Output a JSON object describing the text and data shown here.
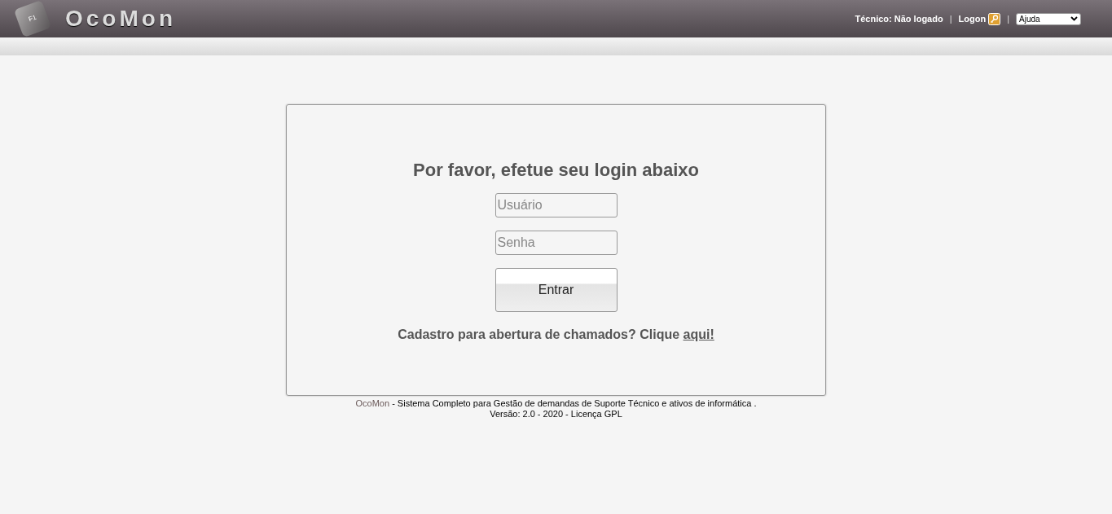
{
  "header": {
    "logo_key": "F1",
    "logo_text": "OcoMon",
    "user_label": "Técnico: Não logado",
    "separator": "|",
    "logon": "Logon",
    "help_select": {
      "value": "Ajuda"
    }
  },
  "login": {
    "title": "Por favor, efetue seu login abaixo",
    "username": {
      "placeholder": "Usuário"
    },
    "password": {
      "placeholder": "Senha"
    },
    "submit": "Entrar",
    "signup_text": "Cadastro para abertura de chamados? Clique",
    "signup_link": "aqui!"
  },
  "footer": {
    "brand": "OcoMon",
    "description": "- Sistema Completo para Gestão de demandas de Suporte Técnico e ativos de informática .",
    "version": "Versão: 2.0 - 2020 - Licença GPL"
  }
}
